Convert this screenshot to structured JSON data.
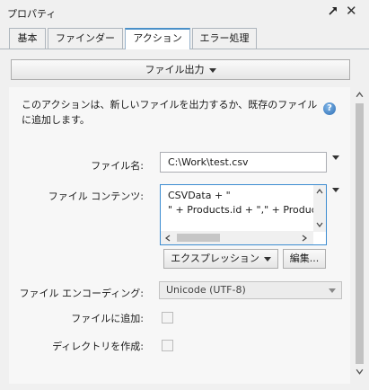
{
  "panel": {
    "title": "プロパティ"
  },
  "tabs": [
    {
      "label": "基本"
    },
    {
      "label": "ファインダー"
    },
    {
      "label": "アクション"
    },
    {
      "label": "エラー処理"
    }
  ],
  "action": {
    "menu_label": "ファイル出力",
    "description": "このアクションは、新しいファイルを出力するか、既存のファイルに追加します。"
  },
  "fields": {
    "file_name": {
      "label": "ファイル名:",
      "value": "C:\\Work\\test.csv"
    },
    "file_contents": {
      "label": "ファイル コンテンツ:",
      "line1": "CSVData + \"",
      "line2": "\" + Products.id + \",\" + Products.Na"
    },
    "expression_button": "エクスプレッション",
    "edit_button": "編集...",
    "encoding": {
      "label": "ファイル エンコーディング:",
      "value": "Unicode (UTF-8)"
    },
    "append": {
      "label": "ファイルに追加:"
    },
    "create_dir": {
      "label": "ディレクトリを作成:"
    }
  },
  "icons": {
    "pin": "pin-icon",
    "close": "close-icon",
    "help": "help-icon"
  }
}
